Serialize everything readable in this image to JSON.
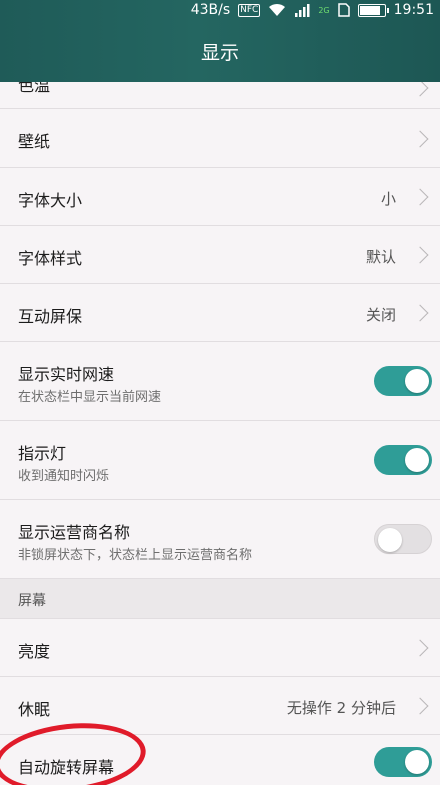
{
  "status_bar": {
    "speed": "43B/s",
    "nfc": "NFC",
    "network": "2G",
    "time": "19:51",
    "icons": [
      "nfc-icon",
      "wifi-icon",
      "signal-icon",
      "sim-icon",
      "battery-icon"
    ]
  },
  "header": {
    "title": "显示"
  },
  "rows": [
    {
      "label": "色温"
    },
    {
      "label": "壁纸"
    },
    {
      "label": "字体大小",
      "value": "小"
    },
    {
      "label": "字体样式",
      "value": "默认"
    },
    {
      "label": "互动屏保",
      "value": "关闭"
    },
    {
      "label": "显示实时网速",
      "sub": "在状态栏中显示当前网速",
      "toggle": "on"
    },
    {
      "label": "指示灯",
      "sub": "收到通知时闪烁",
      "toggle": "on"
    },
    {
      "label": "显示运营商名称",
      "sub": "非锁屏状态下，状态栏上显示运营商名称",
      "toggle": "off"
    }
  ],
  "section_screen": {
    "label": "屏幕"
  },
  "rows2": [
    {
      "label": "亮度"
    },
    {
      "label": "休眠",
      "value": "无操作 2 分钟后"
    },
    {
      "label": "自动旋转屏幕",
      "toggle": "on"
    }
  ],
  "colors": {
    "header_bg": "#1f5b58",
    "toggle_on": "#2f9d97",
    "annotation": "#e01b2a"
  }
}
